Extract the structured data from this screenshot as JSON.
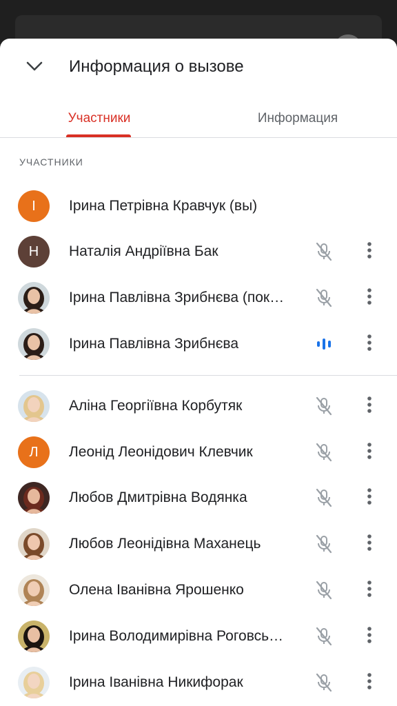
{
  "header": {
    "title": "Информация о вызове",
    "collapse_icon": "chevron-down-icon"
  },
  "tabs": [
    {
      "label": "Участники",
      "active": true
    },
    {
      "label": "Информация",
      "active": false
    }
  ],
  "section_label": "УЧАСТНИКИ",
  "colors": {
    "accent": "#d93025",
    "speaking": "#1a73e8",
    "muted_icon": "#9aa0a6",
    "avatar_orange": "#e8711a",
    "avatar_brown": "#5d4037"
  },
  "participants": [
    {
      "name": "Ірина Петрівна Кравчук (вы)",
      "avatar": {
        "type": "letter",
        "letter": "І",
        "color": "#e8711a"
      },
      "status": "none",
      "has_menu": false
    },
    {
      "name": "Наталія Андріївна Бак",
      "avatar": {
        "type": "letter",
        "letter": "Н",
        "color": "#5d4037"
      },
      "status": "muted",
      "has_menu": true
    },
    {
      "name": "Ірина Павлівна Зрибнєва (пок…",
      "avatar": {
        "type": "photo",
        "hair": "#2b1d17",
        "skin": "#e9c2a6",
        "bg": "#cfd8dc"
      },
      "status": "muted",
      "has_menu": true
    },
    {
      "name": "Ірина Павлівна Зрибнєва",
      "avatar": {
        "type": "photo",
        "hair": "#2b1d17",
        "skin": "#e9c2a6",
        "bg": "#cfd8dc"
      },
      "status": "speaking",
      "has_menu": true
    },
    {
      "name": "Аліна Георгіївна Корбутяк",
      "avatar": {
        "type": "photo",
        "hair": "#e3c68e",
        "skin": "#f2d3bd",
        "bg": "#d7e3ec"
      },
      "status": "muted",
      "has_menu": true
    },
    {
      "name": "Леонід Леонідович Клевчик",
      "avatar": {
        "type": "letter",
        "letter": "Л",
        "color": "#e8711a"
      },
      "status": "muted",
      "has_menu": true
    },
    {
      "name": "Любов Дмитрівна Водянка",
      "avatar": {
        "type": "photo",
        "hair": "#6b2a1e",
        "skin": "#e6b89c",
        "bg": "#3e2723"
      },
      "status": "muted",
      "has_menu": true
    },
    {
      "name": "Любов Леонідівна Маханець",
      "avatar": {
        "type": "photo",
        "hair": "#7a4a2a",
        "skin": "#efc7ae",
        "bg": "#e0d6c8"
      },
      "status": "muted",
      "has_menu": true
    },
    {
      "name": "Олена Іванівна Ярошенко",
      "avatar": {
        "type": "photo",
        "hair": "#b08456",
        "skin": "#f0cdb4",
        "bg": "#ede7dd"
      },
      "status": "muted",
      "has_menu": true
    },
    {
      "name": "Ірина Володимирівна Роговсь…",
      "avatar": {
        "type": "photo",
        "hair": "#1b1410",
        "skin": "#e8bfa3",
        "bg": "#c9b36a"
      },
      "status": "muted",
      "has_menu": true
    },
    {
      "name": "Ірина Іванівна Никифорак",
      "avatar": {
        "type": "photo",
        "hair": "#e8cf9a",
        "skin": "#f3d6c2",
        "bg": "#e8eef3"
      },
      "status": "muted",
      "has_menu": true
    }
  ]
}
